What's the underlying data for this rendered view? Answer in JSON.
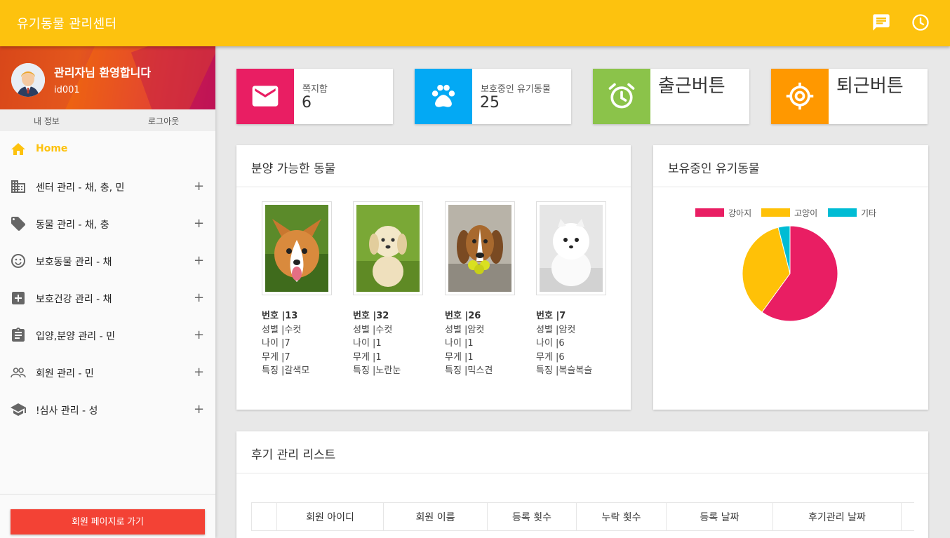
{
  "app": {
    "title": "유기동물 관리센터"
  },
  "header_icons": [
    "message-icon",
    "clock-icon"
  ],
  "sidebar": {
    "welcome": "관리자님 환영합니다",
    "user_id": "id001",
    "my_info": "내 정보",
    "logout": "로그아웃",
    "items": [
      {
        "label": "Home",
        "icon": "home-icon",
        "active": true
      },
      {
        "label": "센터 관리 - 채, 충, 민",
        "icon": "building-icon"
      },
      {
        "label": "동물 관리 - 채, 충",
        "icon": "tag-icon"
      },
      {
        "label": "보호동물 관리 - 채",
        "icon": "smiley-icon"
      },
      {
        "label": "보호건강 관리 - 채",
        "icon": "medical-cross-icon"
      },
      {
        "label": "입양,분양 관리 - 민",
        "icon": "clipboard-icon"
      },
      {
        "label": "회원 관리 - 민",
        "icon": "people-icon"
      },
      {
        "label": "!심사 관리 - 성",
        "icon": "graduation-cap-icon"
      }
    ],
    "expand_symbol": "+",
    "footer_button": "회원 페이지로 가기"
  },
  "info_boxes": [
    {
      "label": "쪽지함",
      "value": "6",
      "color": "#e91e63",
      "icon": "mail-icon"
    },
    {
      "label": "보호중인 유기동물",
      "value": "25",
      "color": "#03a9f4",
      "icon": "paw-icon"
    },
    {
      "label": "출근버튼",
      "color": "#8bc34a",
      "icon": "alarm-icon"
    },
    {
      "label": "퇴근버튼",
      "color": "#ff9800",
      "icon": "target-icon"
    }
  ],
  "adoptable": {
    "title": "분양 가능한 동물",
    "animals": [
      {
        "no": "번호 |13",
        "sex": "성별 |수컷",
        "age": "나이 |7",
        "weight": "무게 |7",
        "feature": "특징 |갈색모"
      },
      {
        "no": "번호 |32",
        "sex": "성별 |수컷",
        "age": "나이 |1",
        "weight": "무게 |1",
        "feature": "특징 |노란눈"
      },
      {
        "no": "번호 |26",
        "sex": "성별 |암컷",
        "age": "나이 |1",
        "weight": "무게 |1",
        "feature": "특징 |믹스견"
      },
      {
        "no": "번호 |7",
        "sex": "성별 |암컷",
        "age": "나이 |6",
        "weight": "무게 |6",
        "feature": "특징 |복슬복슬"
      }
    ]
  },
  "owned": {
    "title": "보유중인 유기동물",
    "chart_data": {
      "type": "pie",
      "labels": [
        "강아지",
        "고양이",
        "기타"
      ],
      "values": [
        60,
        36,
        4
      ],
      "colors": [
        "#e91e63",
        "#ffc107",
        "#00bcd4"
      ],
      "legend": "top"
    }
  },
  "review": {
    "title": "후기 관리 리스트",
    "columns": [
      "",
      "회원 아이디",
      "회원 이름",
      "등록 횟수",
      "누락 횟수",
      "등록 날짜",
      "후기관리 날짜",
      ""
    ]
  }
}
